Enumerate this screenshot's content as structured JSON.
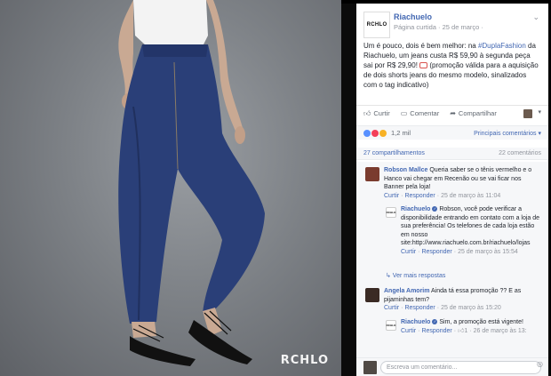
{
  "photo": {
    "brand_watermark": "RCHLO"
  },
  "post": {
    "page_logo": "RCHLO",
    "page_name": "Riachuelo",
    "page_sub": "Página curtida · 25 de março ·",
    "chevron": "⌄",
    "text_before_tag": "Um é pouco, dois é bem melhor: na ",
    "hashtag": "#DuplaFashion",
    "text_after_tag": " da Riachuelo, um jeans custa R$ 59,90 à segunda peça sai por R$ 29,90! ",
    "text_end": " (promoção válida para a aquisição de dois shorts jeans do mesmo modelo, sinalizados com o tag indicativo)"
  },
  "actions": {
    "like": "Curtir",
    "comment": "Comentar",
    "share": "Compartilhar"
  },
  "reactions": {
    "count": "1,2 mil",
    "relevant": "Principais comentários ▾"
  },
  "stats": {
    "shares": "27 compartilhamentos",
    "comments": "22 comentários"
  },
  "comments": [
    {
      "author": "Robson Mallce",
      "text": "Queria saber se o tênis vermelho e o Hanco vai chegar em Recenão ou se vai ficar nos Banner pela loja!",
      "like": "Curtir",
      "reply": "Responder",
      "time": "25 de março às 11:04"
    },
    {
      "author": "Riachuelo",
      "text": "Robson, você pode verificar a disponibilidade entrando em contato com a loja de sua preferência! Os telefones de cada loja estão em nosso site:http://www.riachuelo.com.br/riachuelo/lojas",
      "like": "Curtir",
      "reply": "Responder",
      "time": "25 de março às 15:54"
    },
    {
      "more": "↳ Ver mais respostas"
    },
    {
      "author": "Angela Amorim",
      "text": "Ainda tá essa promoção ?? E as pijaminhas tem?",
      "like": "Curtir",
      "reply": "Responder",
      "time": "25 de março às 15:20"
    },
    {
      "author": "Riachuelo",
      "text": "Sim, a promoção está vigente!",
      "like": "Curtir",
      "reply": "Responder",
      "likes": "1",
      "time": "26 de março às 13:"
    }
  ],
  "write": {
    "placeholder": "Escreva um comentário...",
    "camera_icon": "◎"
  },
  "colors": {
    "link": "#4267b2",
    "like_react": "#5890ff",
    "love_react": "#f33e58",
    "haha_react": "#f7b125"
  }
}
